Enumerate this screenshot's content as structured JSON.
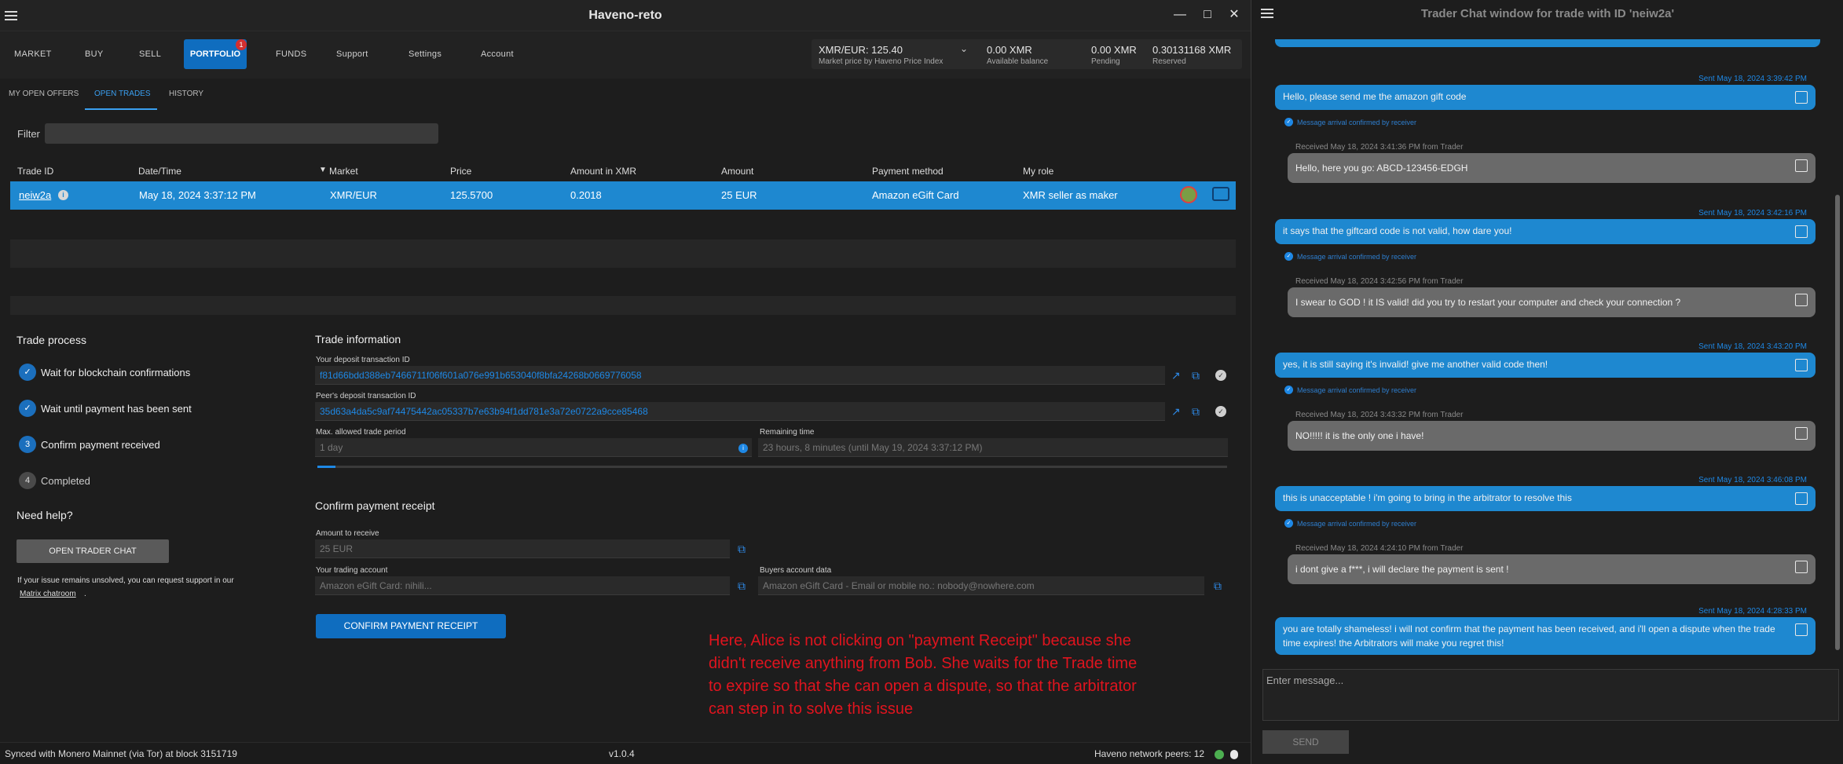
{
  "window": {
    "title": "Haveno-reto",
    "controls": {
      "minimize": "—",
      "maximize": "□",
      "close": "✕"
    }
  },
  "nav": {
    "items": [
      "MARKET",
      "BUY",
      "SELL",
      "PORTFOLIO",
      "FUNDS",
      "Support",
      "Settings",
      "Account"
    ],
    "portfolio_badge": "1"
  },
  "price": {
    "pair": "XMR/EUR: 125.40",
    "pair_sub": "Market price by Haveno Price Index",
    "available": "0.00 XMR",
    "available_lbl": "Available balance",
    "pending": "0.00 XMR",
    "pending_lbl": "Pending",
    "reserved": "0.30131168 XMR",
    "reserved_lbl": "Reserved"
  },
  "subtabs": [
    "MY OPEN OFFERS",
    "OPEN TRADES",
    "HISTORY"
  ],
  "filter": {
    "label": "Filter",
    "value": ""
  },
  "table": {
    "headers": [
      "Trade ID",
      "Date/Time",
      "Market",
      "Price",
      "Amount in XMR",
      "Amount",
      "Payment method",
      "My role"
    ],
    "sort_indicator": "▼",
    "row": {
      "id": "neiw2a",
      "datetime": "May 18, 2024 3:37:12 PM",
      "market": "XMR/EUR",
      "price": "125.5700",
      "amount_xmr": "0.2018",
      "amount": "25 EUR",
      "payment": "Amazon eGift Card",
      "role": "XMR seller as maker"
    }
  },
  "process": {
    "title": "Trade process",
    "steps": [
      {
        "n": "✓",
        "label": "Wait for blockchain confirmations"
      },
      {
        "n": "✓",
        "label": "Wait until payment has been sent"
      },
      {
        "n": "3",
        "label": "Confirm payment received"
      },
      {
        "n": "4",
        "label": "Completed"
      }
    ],
    "help_title": "Need help?",
    "chat_btn": "OPEN TRADER CHAT",
    "help_text": "If your issue remains unsolved, you can request support in our",
    "help_link": "Matrix chatroom",
    "help_end": "."
  },
  "info": {
    "title": "Trade information",
    "deposit_lbl": "Your deposit transaction ID",
    "deposit_id": "f81d66bdd388eb7466711f06f601a076e991b653040f8bfa24268b0669776058",
    "peer_lbl": "Peer's deposit transaction ID",
    "peer_id": "35d63a4da5c9af74475442ac05337b7e63b94f1dd781e3a72e0722a9cce85468",
    "period_lbl": "Max. allowed trade period",
    "period": "1 day",
    "remaining_lbl": "Remaining time",
    "remaining": "23 hours, 8 minutes (until May 19, 2024 3:37:12 PM)",
    "progress": 0.02
  },
  "confirm": {
    "title": "Confirm payment receipt",
    "amount_lbl": "Amount to receive",
    "amount": "25 EUR",
    "account_lbl": "Your trading account",
    "account": "Amazon eGift Card: nihili...",
    "buyer_lbl": "Buyers account data",
    "buyer": "Amazon eGift Card - Email or mobile no.: nobody@nowhere.com",
    "button": "CONFIRM PAYMENT RECEIPT"
  },
  "annotation": "Here, Alice is not clicking on \"payment Receipt\" because she didn't receive anything from Bob. She waits for the Trade time to expire so that she can open a dispute, so that the arbitrator can step in to solve this issue",
  "footer": {
    "sync": "Synced with Monero Mainnet (via Tor) at block 3151719",
    "version": "v1.0.4",
    "peers": "Haveno network peers: 12"
  },
  "chat": {
    "title": "Trader Chat window for trade with ID 'neiw2a'",
    "ack": "Message arrival confirmed by receiver",
    "messages": [
      {
        "from": "me",
        "time": "Sent May 18, 2024 3:39:42 PM",
        "text": "Hello, please send me the amazon gift code"
      },
      {
        "from": "peer",
        "time": "Received May 18, 2024 3:41:36 PM from Trader",
        "text": "Hello, here you go: ABCD-123456-EDGH"
      },
      {
        "from": "me",
        "time": "Sent May 18, 2024 3:42:16 PM",
        "text": "it says that the giftcard code is not valid, how dare you!"
      },
      {
        "from": "peer",
        "time": "Received May 18, 2024 3:42:56 PM from Trader",
        "text": "I swear to GOD ! it IS valid! did you try to restart your computer and check your connection ?"
      },
      {
        "from": "me",
        "time": "Sent May 18, 2024 3:43:20 PM",
        "text": "yes, it is still saying it's invalid!  give me another valid code then!"
      },
      {
        "from": "peer",
        "time": "Received May 18, 2024 3:43:32 PM from Trader",
        "text": "NO!!!!! it is the only one i have!"
      },
      {
        "from": "me",
        "time": "Sent May 18, 2024 3:46:08 PM",
        "text": "this is unacceptable ! i'm  going to bring in the arbitrator to resolve this"
      },
      {
        "from": "peer",
        "time": "Received May 18, 2024 4:24:10 PM from Trader",
        "text": "i dont give a f***, i will declare the payment is sent !"
      },
      {
        "from": "me",
        "time": "Sent May 18, 2024 4:28:33 PM",
        "text": "you are totally shameless! i will not confirm that the payment has been received, and i'll open a dispute when the trade time expires! the Arbitrators will make you regret this!"
      }
    ],
    "input_placeholder": "Enter message...",
    "send": "SEND"
  }
}
